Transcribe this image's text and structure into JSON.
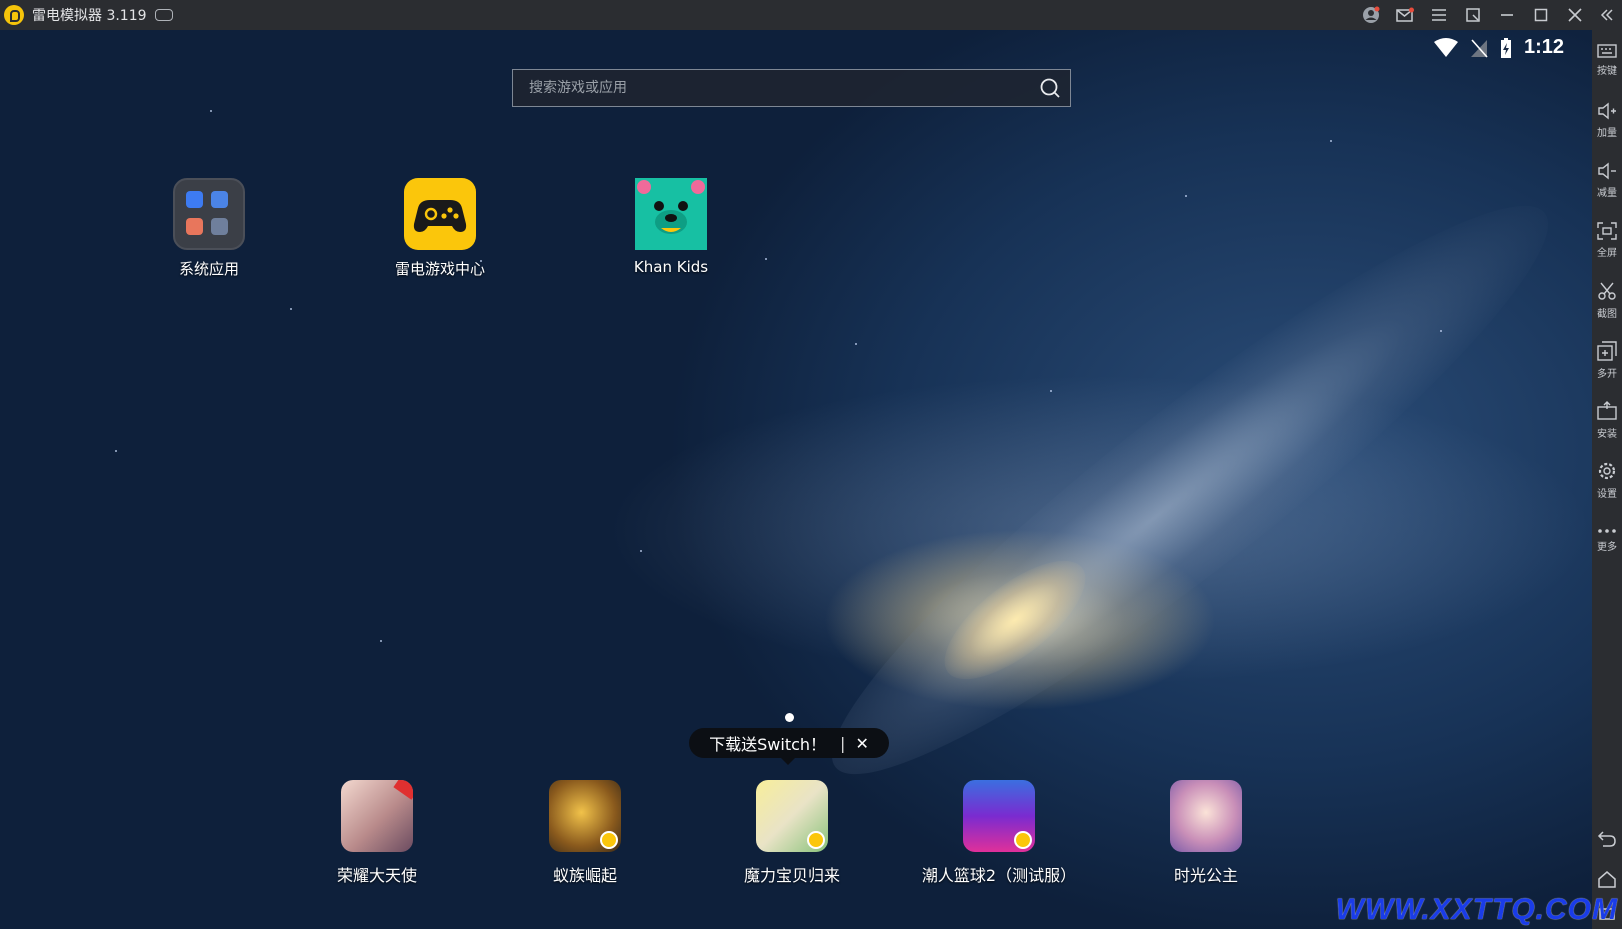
{
  "titlebar": {
    "title": "雷电模拟器 3.119"
  },
  "status": {
    "time": "1:12"
  },
  "search": {
    "placeholder": "搜索游戏或应用"
  },
  "desktop_apps": [
    {
      "label": "系统应用"
    },
    {
      "label": "雷电游戏中心"
    },
    {
      "label": "Khan Kids"
    }
  ],
  "tooltip": {
    "text": "下载送Switch！",
    "separator": "|",
    "close": "✕"
  },
  "dock_apps": [
    {
      "label": "荣耀大天使"
    },
    {
      "label": "蚁族崛起"
    },
    {
      "label": "魔力宝贝归来"
    },
    {
      "label": "潮人篮球2（测试服）"
    },
    {
      "label": "时光公主"
    }
  ],
  "sidebar": {
    "items": [
      {
        "label": "按键"
      },
      {
        "label": "加量"
      },
      {
        "label": "减量"
      },
      {
        "label": "全屏"
      },
      {
        "label": "截图"
      },
      {
        "label": "多开"
      },
      {
        "label": "安装"
      },
      {
        "label": "设置"
      },
      {
        "label": "更多"
      }
    ]
  },
  "watermark": "WWW.XXTTQ.COM",
  "colors": {
    "titlebar_bg": "#2b2d31",
    "brand_yellow": "#fbc60b",
    "khan_green": "#17c0a3",
    "watermark_blue": "#1a3ce8"
  }
}
